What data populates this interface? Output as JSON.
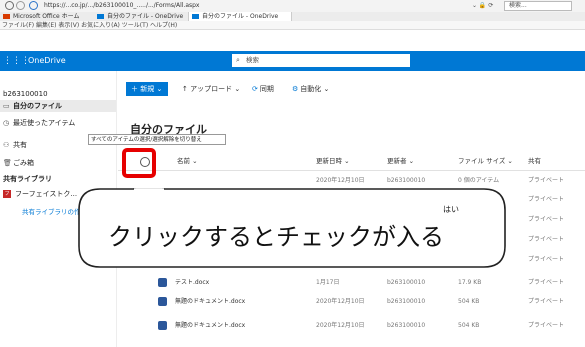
{
  "browser": {
    "url": "https://...co.jp/.../b263100010_...../.../Forms/All.aspx",
    "search_placeholder": "検索...",
    "addr_icons": "⌄ 🔒 ⟳",
    "tabs": [
      {
        "label": "Microsoft Office ホーム"
      },
      {
        "label": "自分のファイル - OneDrive"
      },
      {
        "label": "自分のファイル - OneDrive"
      }
    ],
    "menu": "ファイル(F)  編集(E)  表示(V)  お気に入り(A)  ツール(T)  ヘルプ(H)"
  },
  "header": {
    "waffle": "⋮⋮⋮",
    "title": "OneDrive",
    "search_placeholder": "検索"
  },
  "sidebar": {
    "account": "b263100010",
    "my_files": "自分のファイル",
    "recent": "最近使ったアイテム",
    "shared": "共有",
    "recycle": "ごみ箱",
    "libraries_heading": "共有ライブラリ",
    "library_1": "フーフェイストク...",
    "create_library": "共有ライブラリの作成"
  },
  "commands": {
    "new": "＋ 新規 ⌄",
    "upload": "↑ アップロード ⌄",
    "sync": "同期",
    "flow": "自動化 ⌄"
  },
  "tooltip": "すべてのアイテムの選択/選択解除を切り替え",
  "heading": "自分のファイル",
  "table": {
    "headers": {
      "name": "名前 ⌄",
      "modified": "更新日時 ⌄",
      "modified_by": "更新者 ⌄",
      "size": "ファイル サイズ ⌄",
      "sharing": "共有"
    },
    "rows": [
      {
        "name": "",
        "modified": "2020年12月10日",
        "by": "b263100010",
        "size": "0 個のアイテム",
        "share": "プライベート",
        "doc": false
      },
      {
        "name": "",
        "modified": "",
        "by": "",
        "size": "",
        "share": "プライベート",
        "doc": false
      },
      {
        "name": "",
        "modified": "",
        "by": "",
        "size": "",
        "share": "プライベート",
        "doc": false
      },
      {
        "name": "",
        "modified": "",
        "by": "",
        "size": "",
        "share": "プライベート",
        "doc": false
      },
      {
        "name": "",
        "modified": "",
        "by": "",
        "size": "",
        "share": "プライベート",
        "doc": false
      },
      {
        "name": "テスト.docx",
        "modified": "1月17日",
        "by": "b263100010",
        "size": "17.9 KB",
        "share": "プライベート",
        "doc": true
      },
      {
        "name": "無題のドキュメント.docx",
        "modified": "2020年12月10日",
        "by": "b263100010",
        "size": "504 KB",
        "share": "プライベート",
        "doc": true
      },
      {
        "name": "無題のドキュメント.docx",
        "modified": "2020年12月10日",
        "by": "b263100010",
        "size": "504 KB",
        "share": "プライベート",
        "doc": true
      }
    ]
  },
  "callout": {
    "text": "クリックするとチェックが入る",
    "ruby": "はい"
  },
  "colors": {
    "accent": "#0078d4",
    "highlight": "#e60000"
  }
}
